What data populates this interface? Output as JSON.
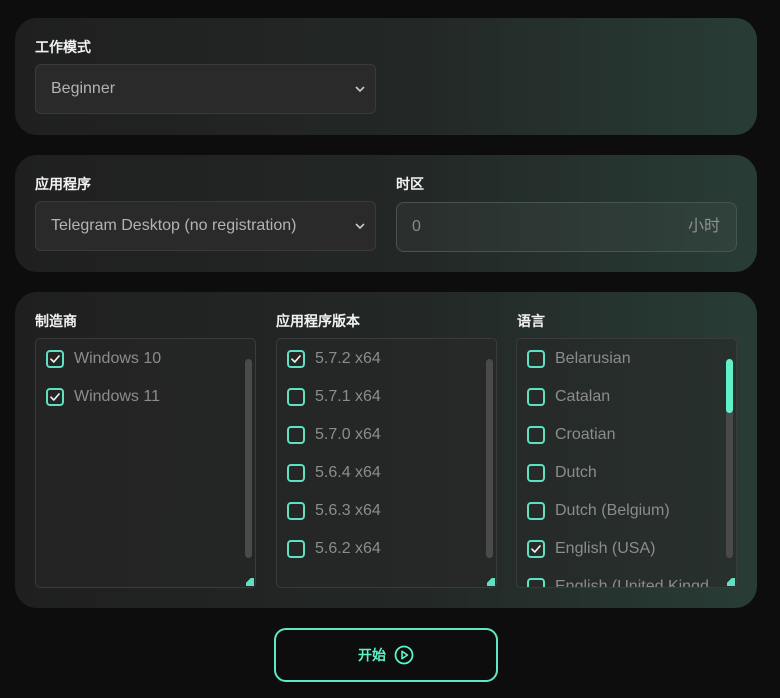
{
  "mode": {
    "label": "工作模式",
    "value": "Beginner"
  },
  "application": {
    "label": "应用程序",
    "value": "Telegram Desktop (no registration)"
  },
  "timezone": {
    "label": "时区",
    "value": "0",
    "unit": "小时"
  },
  "manufacturer": {
    "label": "制造商",
    "items": [
      {
        "label": "Windows 10",
        "checked": true
      },
      {
        "label": "Windows 11",
        "checked": true
      }
    ]
  },
  "app_version": {
    "label": "应用程序版本",
    "items": [
      {
        "label": "5.7.2 x64",
        "checked": true
      },
      {
        "label": "5.7.1 x64",
        "checked": false
      },
      {
        "label": "5.7.0 x64",
        "checked": false
      },
      {
        "label": "5.6.4 x64",
        "checked": false
      },
      {
        "label": "5.6.3 x64",
        "checked": false
      },
      {
        "label": "5.6.2 x64",
        "checked": false
      }
    ]
  },
  "language": {
    "label": "语言",
    "items": [
      {
        "label": "Belarusian",
        "checked": false
      },
      {
        "label": "Catalan",
        "checked": false
      },
      {
        "label": "Croatian",
        "checked": false
      },
      {
        "label": "Dutch",
        "checked": false
      },
      {
        "label": "Dutch (Belgium)",
        "checked": false
      },
      {
        "label": "English (USA)",
        "checked": true
      },
      {
        "label": "English (United Kingd",
        "checked": false
      }
    ]
  },
  "start_button": {
    "label": "开始",
    "icon": "play-circle-icon"
  },
  "colors": {
    "accent": "#5ff2c8",
    "background": "#0d0d0d"
  }
}
